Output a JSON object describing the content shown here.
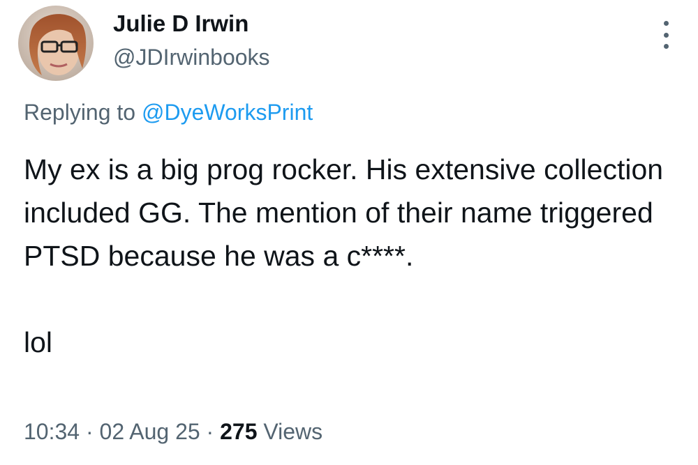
{
  "author": {
    "display_name": "Julie D Irwin",
    "handle": "@JDIrwinbooks",
    "avatar_icon": "profile-photo"
  },
  "reply": {
    "prefix": "Replying to ",
    "target": "@DyeWorksPrint"
  },
  "content": {
    "paragraph_1": "My ex is a big prog rocker. His extensive collection included GG. The mention of their name triggered PTSD because he was a c****.",
    "paragraph_2": "lol"
  },
  "meta": {
    "time": "10:34",
    "separator_1": " · ",
    "date": "02 Aug 25",
    "separator_2": " · ",
    "views_count": "275",
    "views_label": " Views"
  },
  "colors": {
    "text_primary": "#0f1419",
    "text_secondary": "#536471",
    "link": "#1d9bf0",
    "background": "#ffffff"
  },
  "icons": {
    "more": "more-vertical-icon"
  }
}
